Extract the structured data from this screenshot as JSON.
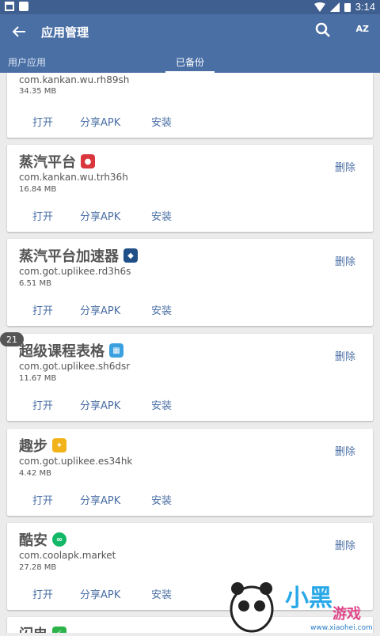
{
  "status_bar": {
    "time": "3:14"
  },
  "app_bar": {
    "title": "应用管理",
    "sort_label": "AZ"
  },
  "tabs": [
    {
      "label": "用户应用"
    },
    {
      "label": "已备份"
    }
  ],
  "apps": [
    {
      "name": "",
      "package": "com.kankan.wu.rh89sh",
      "size": "34.35 MB",
      "open": "打开",
      "share": "分享APK",
      "install": "安装",
      "delete": ""
    },
    {
      "name": "蒸汽平台",
      "icon": "steam-icon",
      "icon_color": "#d9363e",
      "package": "com.kankan.wu.trh36h",
      "size": "16.84 MB",
      "open": "打开",
      "share": "分享APK",
      "install": "安装",
      "delete": "删除"
    },
    {
      "name": "蒸汽平台加速器",
      "icon": "gamepad-icon",
      "icon_color": "#1f4f86",
      "package": "com.got.uplikee.rd3h6s",
      "size": "6.51 MB",
      "open": "打开",
      "share": "分享APK",
      "install": "安装",
      "delete": "删除"
    },
    {
      "name": "超级课程表格",
      "icon": "schedule-icon",
      "icon_color": "#3aa0e0",
      "package": "com.got.uplikee.sh6dsr",
      "size": "11.67 MB",
      "open": "打开",
      "share": "分享APK",
      "install": "安装",
      "delete": "删除"
    },
    {
      "name": "趣步",
      "icon": "qubu-icon",
      "icon_color": "#f2b21a",
      "package": "com.got.uplikee.es34hk",
      "size": "4.42 MB",
      "open": "打开",
      "share": "分享APK",
      "install": "安装",
      "delete": "删除"
    },
    {
      "name": "酷安",
      "icon": "coolapk-icon",
      "icon_color": "#11b868",
      "package": "com.coolapk.market",
      "size": "27.28 MB",
      "open": "打开",
      "share": "分享APK",
      "install": "安装",
      "delete": "删除"
    },
    {
      "name": "闪电",
      "icon": "green-app-icon",
      "icon_color": "#2bb34a",
      "package": "",
      "size": "",
      "open": "",
      "share": "",
      "install": "",
      "delete": ""
    }
  ],
  "scroll_bubble": "21",
  "watermark": {
    "line1": "小黑游戏",
    "line2": "www.xiaohei.com"
  },
  "colors": {
    "primary": "#4a6fa5",
    "status": "#3e5f90"
  }
}
